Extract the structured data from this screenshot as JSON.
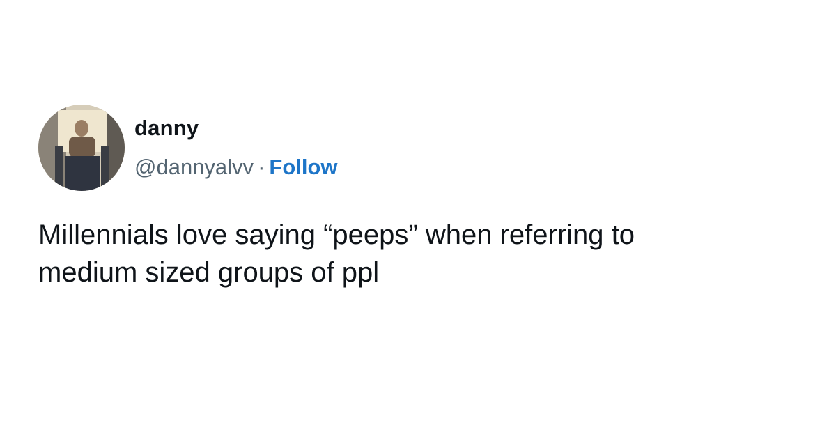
{
  "tweet": {
    "author": {
      "display_name": "danny",
      "handle": "@dannyalvv",
      "separator": "·",
      "follow_label": "Follow"
    },
    "text_line_1": "Millennials love saying “peeps” when referring to",
    "text_line_2": "medium sized groups of ppl"
  },
  "colors": {
    "follow_link": "#1d75c8",
    "handle": "#536471",
    "text": "#0f1419",
    "background": "#ffffff"
  }
}
